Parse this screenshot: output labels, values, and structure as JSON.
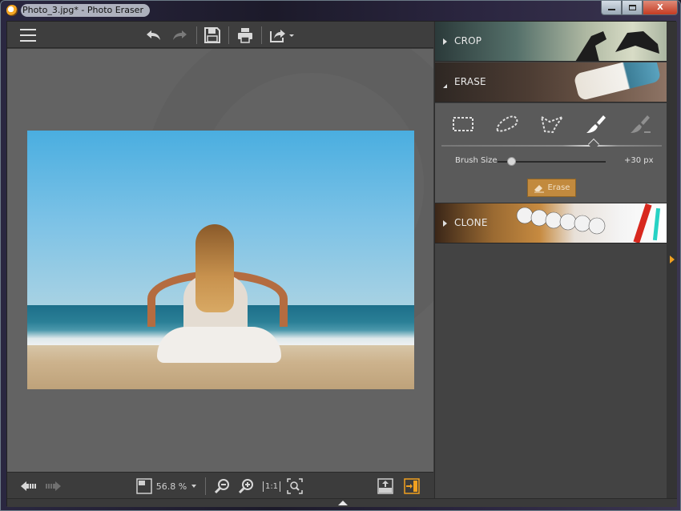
{
  "window": {
    "title": "Photo_3.jpg* - Photo Eraser",
    "controls": {
      "minimize": "–",
      "maximize": "□",
      "close": "X"
    }
  },
  "toolbar": {
    "menu_icon": "hamburger-icon",
    "undo_icon": "undo-icon",
    "redo_icon": "redo-icon",
    "save_icon": "save-icon",
    "print_icon": "print-icon",
    "share_icon": "share-icon"
  },
  "canvas": {
    "image_alt": "Woman meditating on beach facing the sea"
  },
  "statusbar": {
    "prev_icon": "prev-image-icon",
    "next_icon": "next-image-icon",
    "zoom_value": "56.8 %",
    "zoom_out_icon": "zoom-out-icon",
    "zoom_in_icon": "zoom-in-icon",
    "actual_size_label": "1:1",
    "fit_icon": "zoom-fit-icon",
    "export_icon": "export-icon",
    "panel_toggle_icon": "panel-toggle-icon"
  },
  "right_panel": {
    "sections": [
      {
        "label": "CROP",
        "expanded": false
      },
      {
        "label": "ERASE",
        "expanded": true
      },
      {
        "label": "CLONE",
        "expanded": false
      }
    ],
    "erase": {
      "tools": [
        {
          "name": "rectangle-select",
          "active": false
        },
        {
          "name": "lasso-select",
          "active": false
        },
        {
          "name": "polygon-select",
          "active": false
        },
        {
          "name": "brush",
          "active": true
        },
        {
          "name": "eraser-brush",
          "active": false
        }
      ],
      "brush_size_label": "Brush Size",
      "brush_size_value": "+30 px",
      "brush_size_fraction": 0.1,
      "erase_button_label": "Erase"
    }
  },
  "colors": {
    "accent": "#f0a020",
    "erase_button": "#c28a3e",
    "panel_bg": "#434343",
    "canvas_bg": "#636363"
  }
}
